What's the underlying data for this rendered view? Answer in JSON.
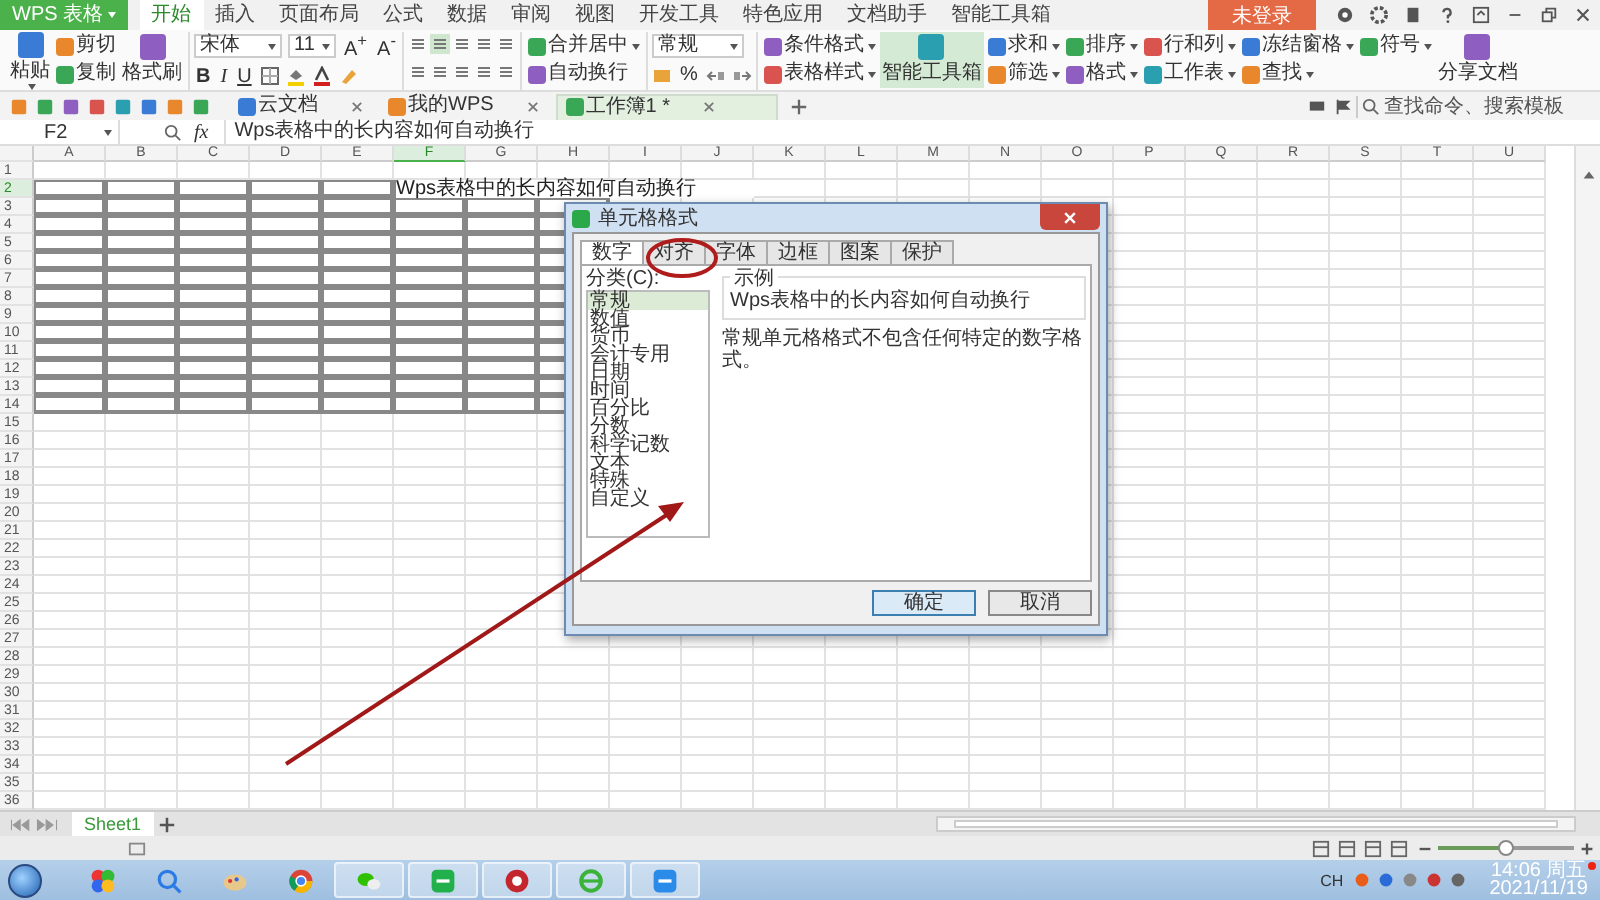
{
  "app_menu": {
    "label": "WPS 表格"
  },
  "menu_tabs": [
    {
      "label": "开始",
      "selected": true
    },
    {
      "label": "插入",
      "selected": false
    },
    {
      "label": "页面布局",
      "selected": false
    },
    {
      "label": "公式",
      "selected": false
    },
    {
      "label": "数据",
      "selected": false
    },
    {
      "label": "审阅",
      "selected": false
    },
    {
      "label": "视图",
      "selected": false
    },
    {
      "label": "开发工具",
      "selected": false
    },
    {
      "label": "特色应用",
      "selected": false
    },
    {
      "label": "文档助手",
      "selected": false
    },
    {
      "label": "智能工具箱",
      "selected": false
    }
  ],
  "login_button": {
    "label": "未登录"
  },
  "ribbon": {
    "clipboard": [
      {
        "label": "粘贴",
        "kind": "large",
        "dropdown": true
      },
      {
        "label": "剪切",
        "kind": "small",
        "dropdown": false
      },
      {
        "label": "复制",
        "kind": "small",
        "dropdown": false
      },
      {
        "label": "格式刷",
        "kind": "large",
        "dropdown": false
      }
    ],
    "font": {
      "family": "宋体",
      "size": "11",
      "size_buttons": [
        "A$^{+}$",
        "A$^{-}$"
      ],
      "styles": [
        "B",
        "I",
        "U"
      ]
    },
    "alignment": [
      {
        "selected": false
      },
      {
        "selected": true
      },
      {
        "selected": false
      },
      {
        "selected": false
      },
      {
        "selected": false
      },
      {
        "selected": false
      },
      {
        "selected": false
      },
      {
        "selected": false
      },
      {
        "selected": false
      },
      {
        "selected": false
      }
    ],
    "merge": [
      {
        "label": "合并居中",
        "dropdown": true
      },
      {
        "label": "自动换行",
        "dropdown": false
      }
    ],
    "number": {
      "format": "常规",
      "percent": "%"
    },
    "tools": [
      {
        "label": "条件格式",
        "kind": "small",
        "dropdown": true,
        "selected": false
      },
      {
        "label": "表格样式",
        "kind": "small",
        "dropdown": true,
        "selected": false
      },
      {
        "label": "智能工具箱",
        "kind": "large",
        "dropdown": false,
        "selected": true
      },
      {
        "label": "求和",
        "kind": "small",
        "dropdown": true,
        "selected": false
      },
      {
        "label": "筛选",
        "kind": "small",
        "dropdown": true,
        "selected": false
      },
      {
        "label": "排序",
        "kind": "small",
        "dropdown": true,
        "selected": false
      },
      {
        "label": "格式",
        "kind": "small",
        "dropdown": true,
        "selected": false
      },
      {
        "label": "行和列",
        "kind": "small",
        "dropdown": true,
        "selected": false
      },
      {
        "label": "工作表",
        "kind": "small",
        "dropdown": true,
        "selected": false
      },
      {
        "label": "冻结窗格",
        "kind": "small",
        "dropdown": true,
        "selected": false
      },
      {
        "label": "查找",
        "kind": "small",
        "dropdown": true,
        "selected": false
      },
      {
        "label": "符号",
        "kind": "small",
        "dropdown": true,
        "selected": false
      },
      {
        "label": "分享文档",
        "kind": "large",
        "dropdown": false,
        "selected": false
      }
    ],
    "search": {
      "placeholder": "查找命令、搜索模板"
    }
  },
  "doc_tabs": [
    {
      "label": "云文档",
      "selected": false
    },
    {
      "label": "我的WPS",
      "selected": false
    },
    {
      "label": "工作簿1 *",
      "selected": true
    }
  ],
  "formula_bar": {
    "cell_ref": "F2",
    "fx": "fx",
    "value": "Wps表格中的长内容如何自动换行"
  },
  "sheet": {
    "columns": [
      {
        "label": "A",
        "selected": false,
        "bordered": true
      },
      {
        "label": "B",
        "selected": false,
        "bordered": true
      },
      {
        "label": "C",
        "selected": false,
        "bordered": true
      },
      {
        "label": "D",
        "selected": false,
        "bordered": true
      },
      {
        "label": "E",
        "selected": false,
        "bordered": true
      },
      {
        "label": "F",
        "selected": true,
        "bordered": true
      },
      {
        "label": "G",
        "selected": false,
        "bordered": true
      },
      {
        "label": "H",
        "selected": false,
        "bordered": true
      },
      {
        "label": "I",
        "selected": false,
        "bordered": false
      },
      {
        "label": "J",
        "selected": false,
        "bordered": false
      },
      {
        "label": "K",
        "selected": false,
        "bordered": false
      },
      {
        "label": "L",
        "selected": false,
        "bordered": false
      },
      {
        "label": "M",
        "selected": false,
        "bordered": false
      },
      {
        "label": "N",
        "selected": false,
        "bordered": false
      },
      {
        "label": "O",
        "selected": false,
        "bordered": false
      },
      {
        "label": "P",
        "selected": false,
        "bordered": false
      },
      {
        "label": "Q",
        "selected": false,
        "bordered": false
      },
      {
        "label": "R",
        "selected": false,
        "bordered": false
      },
      {
        "label": "S",
        "selected": false,
        "bordered": false
      },
      {
        "label": "T",
        "selected": false,
        "bordered": false
      },
      {
        "label": "U",
        "selected": false,
        "bordered": false
      }
    ],
    "rows": [
      {
        "label": "1",
        "selected": false,
        "bordered": false
      },
      {
        "label": "2",
        "selected": true,
        "bordered": true
      },
      {
        "label": "3",
        "selected": false,
        "bordered": true
      },
      {
        "label": "4",
        "selected": false,
        "bordered": true
      },
      {
        "label": "5",
        "selected": false,
        "bordered": true
      },
      {
        "label": "6",
        "selected": false,
        "bordered": true
      },
      {
        "label": "7",
        "selected": false,
        "bordered": true
      },
      {
        "label": "8",
        "selected": false,
        "bordered": true
      },
      {
        "label": "9",
        "selected": false,
        "bordered": true
      },
      {
        "label": "10",
        "selected": false,
        "bordered": true
      },
      {
        "label": "11",
        "selected": false,
        "bordered": true
      },
      {
        "label": "12",
        "selected": false,
        "bordered": true
      },
      {
        "label": "13",
        "selected": false,
        "bordered": true
      },
      {
        "label": "14",
        "selected": false,
        "bordered": true
      },
      {
        "label": "15",
        "selected": false,
        "bordered": false
      },
      {
        "label": "16",
        "selected": false,
        "bordered": false
      },
      {
        "label": "17",
        "selected": false,
        "bordered": false
      },
      {
        "label": "18",
        "selected": false,
        "bordered": false
      },
      {
        "label": "19",
        "selected": false,
        "bordered": false
      },
      {
        "label": "20",
        "selected": false,
        "bordered": false
      },
      {
        "label": "21",
        "selected": false,
        "bordered": false
      },
      {
        "label": "22",
        "selected": false,
        "bordered": false
      },
      {
        "label": "23",
        "selected": false,
        "bordered": false
      },
      {
        "label": "24",
        "selected": false,
        "bordered": false
      },
      {
        "label": "25",
        "selected": false,
        "bordered": false
      },
      {
        "label": "26",
        "selected": false,
        "bordered": false
      },
      {
        "label": "27",
        "selected": false,
        "bordered": false
      },
      {
        "label": "28",
        "selected": false,
        "bordered": false
      },
      {
        "label": "29",
        "selected": false,
        "bordered": false
      },
      {
        "label": "30",
        "selected": false,
        "bordered": false
      },
      {
        "label": "31",
        "selected": false,
        "bordered": false
      },
      {
        "label": "32",
        "selected": false,
        "bordered": false
      },
      {
        "label": "33",
        "selected": false,
        "bordered": false
      },
      {
        "label": "34",
        "selected": false,
        "bordered": false
      },
      {
        "label": "35",
        "selected": false,
        "bordered": false
      },
      {
        "label": "36",
        "selected": false,
        "bordered": false
      }
    ],
    "active_cell": {
      "text": "Wps表格中的长内容如何自动换行"
    }
  },
  "sheet_tabs": [
    {
      "label": "Sheet1",
      "selected": true
    }
  ],
  "zoom": {
    "level": 0.5
  },
  "dialog": {
    "title": "单元格格式",
    "tabs": [
      {
        "label": "数字",
        "selected": true
      },
      {
        "label": "对齐",
        "selected": false
      },
      {
        "label": "字体",
        "selected": false
      },
      {
        "label": "边框",
        "selected": false
      },
      {
        "label": "图案",
        "selected": false
      },
      {
        "label": "保护",
        "selected": false
      }
    ],
    "category_label": "分类(C):",
    "categories": [
      {
        "label": "常规",
        "selected": true
      },
      {
        "label": "数值",
        "selected": false
      },
      {
        "label": "货币",
        "selected": false
      },
      {
        "label": "会计专用",
        "selected": false
      },
      {
        "label": "日期",
        "selected": false
      },
      {
        "label": "时间",
        "selected": false
      },
      {
        "label": "百分比",
        "selected": false
      },
      {
        "label": "分数",
        "selected": false
      },
      {
        "label": "科学记数",
        "selected": false
      },
      {
        "label": "文本",
        "selected": false
      },
      {
        "label": "特殊",
        "selected": false
      },
      {
        "label": "自定义",
        "selected": false
      }
    ],
    "sample_label": "示例",
    "sample": "Wps表格中的长内容如何自动换行",
    "description": "常规单元格格式不包含任何特定的数字格式。",
    "buttons": [
      {
        "label": "确定",
        "kind": "primary"
      },
      {
        "label": "取消",
        "kind": "secondary"
      }
    ]
  },
  "taskbar": {
    "language": "CH",
    "time": "14:06 周五",
    "date": "2021/11/19"
  }
}
